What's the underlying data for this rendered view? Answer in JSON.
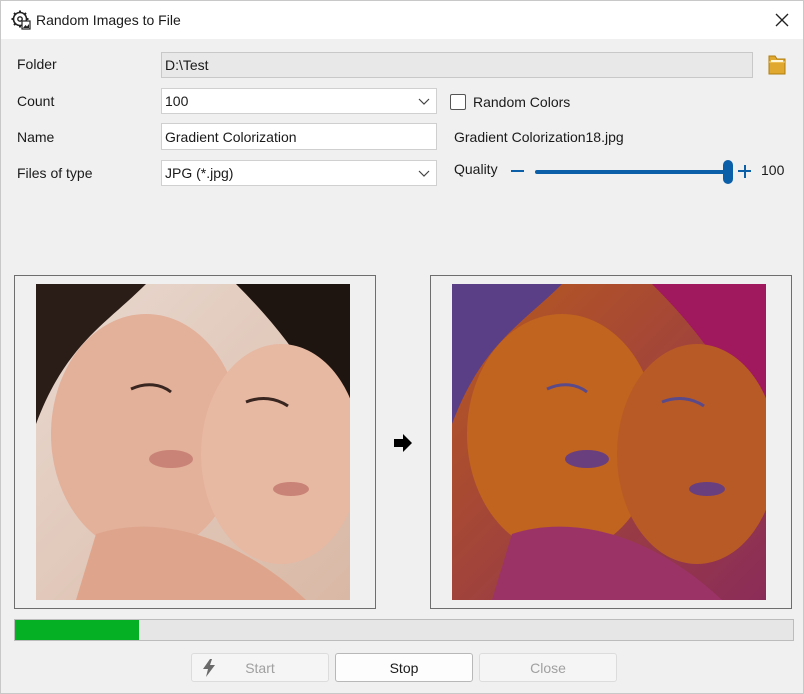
{
  "window": {
    "title": "Random Images to File",
    "icon": "gear-image-icon"
  },
  "form": {
    "folder_label": "Folder",
    "folder_value": "D:\\Test",
    "count_label": "Count",
    "count_value": "100",
    "random_colors_label": "Random Colors",
    "random_colors_checked": false,
    "name_label": "Name",
    "name_value": "Gradient Colorization",
    "output_filename": "Gradient Colorization18.jpg",
    "filetype_label": "Files of type",
    "filetype_value": "JPG (*.jpg)",
    "quality_label": "Quality",
    "quality_value": "100"
  },
  "progress": {
    "fraction": 0.16
  },
  "buttons": {
    "start_label": "Start",
    "stop_label": "Stop",
    "close_label": "Close"
  },
  "colors": {
    "accent": "#0a5fa8",
    "progress": "#06b025"
  }
}
